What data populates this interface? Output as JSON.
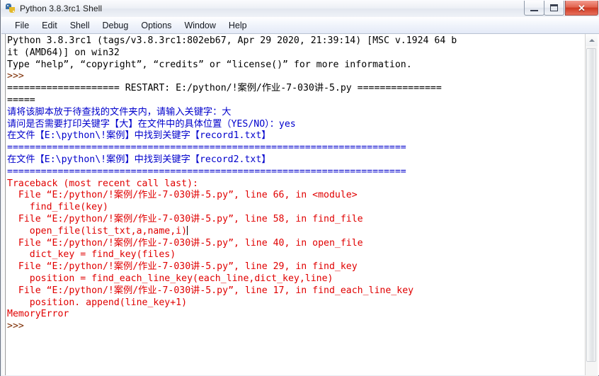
{
  "window": {
    "title": "Python 3.8.3rc1 Shell",
    "icon": "python-logo-icon",
    "controls": {
      "minimize": "–",
      "maximize": "□",
      "close": "✕"
    }
  },
  "menubar": {
    "items": [
      {
        "label": "File"
      },
      {
        "label": "Edit"
      },
      {
        "label": "Shell"
      },
      {
        "label": "Debug"
      },
      {
        "label": "Options"
      },
      {
        "label": "Window"
      },
      {
        "label": "Help"
      }
    ]
  },
  "colors": {
    "stdout_black": "#000000",
    "prompt_brown": "#7c2b00",
    "program_output_blue": "#0000cc",
    "error_red": "#e00000",
    "titlebar_close": "#cf3a22"
  },
  "console": {
    "lines": [
      {
        "color": "black",
        "text": "Python 3.8.3rc1 (tags/v3.8.3rc1:802eb67, Apr 29 2020, 21:39:14) [MSC v.1924 64 b"
      },
      {
        "color": "black",
        "text": "it (AMD64)] on win32"
      },
      {
        "color": "black",
        "text": "Type “help”, “copyright”, “credits” or “license()” for more information."
      },
      {
        "color": "brown",
        "text": ">>>"
      },
      {
        "color": "black",
        "text": "==================== RESTART: E:/python/!案例/作业-7-030讲-5.py ==============="
      },
      {
        "color": "black",
        "text": "====="
      },
      {
        "color": "blue",
        "text": "请将该脚本放于待查找的文件夹内，请输入关键字：大"
      },
      {
        "color": "blue",
        "text": "请问是否需要打印关键字【大】在文件中的具体位置（YES/NO）：yes"
      },
      {
        "color": "blue",
        "text": "在文件【E:\\python\\!案例】中找到关键字【record1.txt】"
      },
      {
        "color": "blue",
        "text": "======================================================================="
      },
      {
        "color": "blue",
        "text": "在文件【E:\\python\\!案例】中找到关键字【record2.txt】"
      },
      {
        "color": "blue",
        "text": "======================================================================="
      },
      {
        "color": "red",
        "text": "Traceback (most recent call last):"
      },
      {
        "color": "red",
        "text": "  File “E:/python/!案例/作业-7-030讲-5.py”, line 66, in <module>"
      },
      {
        "color": "red",
        "text": "    find_file(key)"
      },
      {
        "color": "red",
        "text": "  File “E:/python/!案例/作业-7-030讲-5.py”, line 58, in find_file"
      },
      {
        "color": "red",
        "text": "    open_file(list_txt,a,name,i)",
        "caret": true
      },
      {
        "color": "red",
        "text": "  File “E:/python/!案例/作业-7-030讲-5.py”, line 40, in open_file"
      },
      {
        "color": "red",
        "text": "    dict_key = find_key(files)"
      },
      {
        "color": "red",
        "text": "  File “E:/python/!案例/作业-7-030讲-5.py”, line 29, in find_key"
      },
      {
        "color": "red",
        "text": "    position = find_each_line_key(each_line,dict_key,line)"
      },
      {
        "color": "red",
        "text": "  File “E:/python/!案例/作业-7-030讲-5.py”, line 17, in find_each_line_key"
      },
      {
        "color": "red",
        "text": "    position. append(line_key+1)"
      },
      {
        "color": "red",
        "text": "MemoryError"
      },
      {
        "color": "brown",
        "text": ">>>"
      }
    ]
  },
  "scrollbar": {
    "up_arrow": "▲",
    "orientation": "vertical"
  }
}
